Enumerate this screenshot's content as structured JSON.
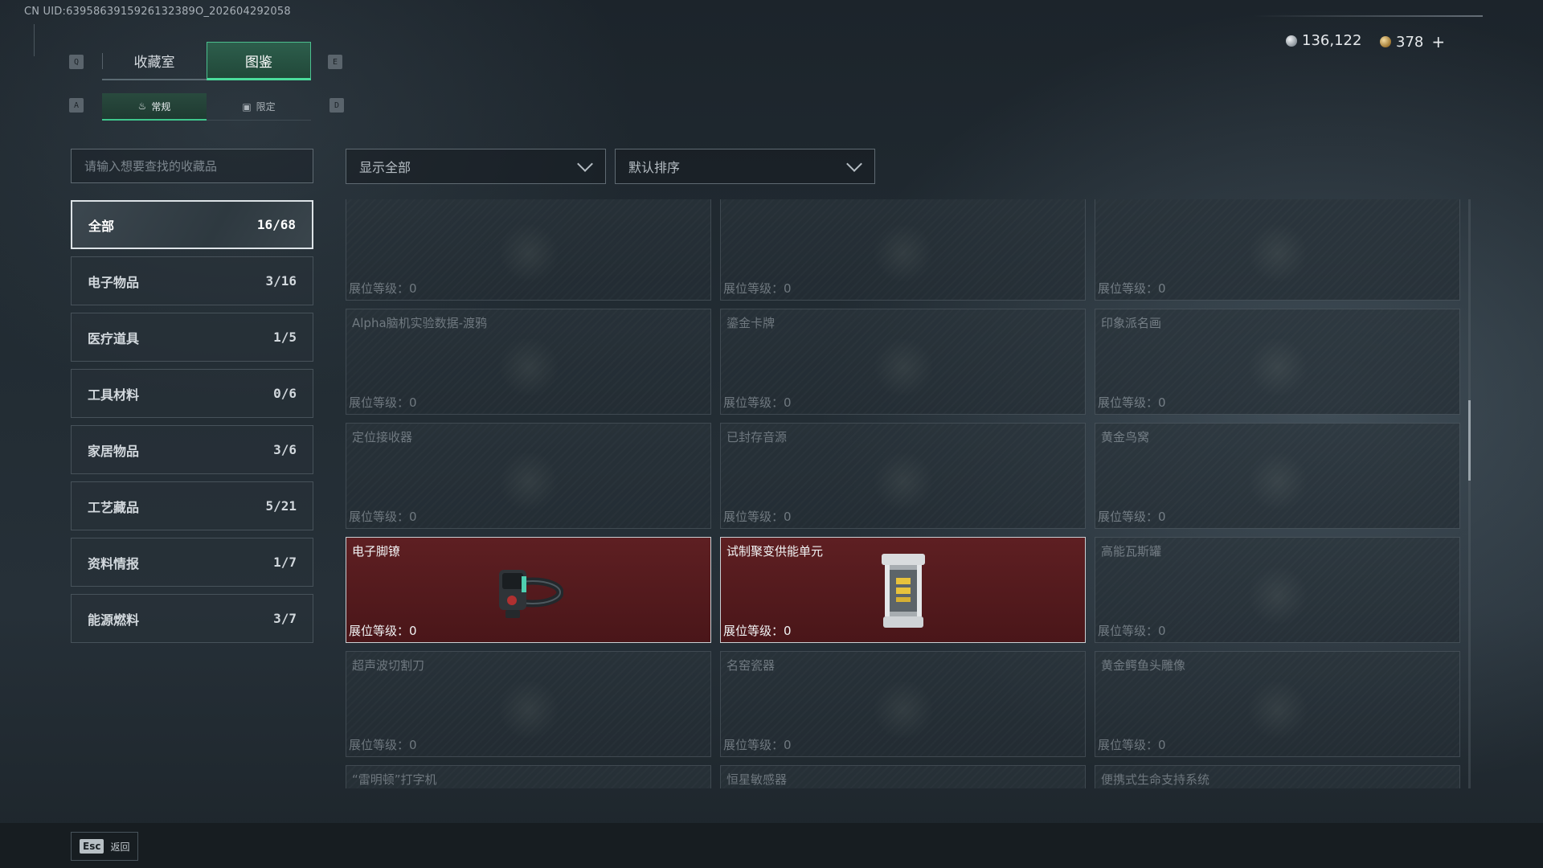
{
  "uid_text": "CN UID:6395863915926132389О_202604292058",
  "currency": {
    "silver": "136,122",
    "gold": "378",
    "plus": "+"
  },
  "keys": {
    "q": "Q",
    "e": "E",
    "a": "A",
    "d": "D"
  },
  "tabs": [
    {
      "label": "收藏室",
      "active": false
    },
    {
      "label": "图鉴",
      "active": true
    }
  ],
  "subtabs": [
    {
      "label": "常规",
      "icon": "flame-icon",
      "active": true
    },
    {
      "label": "限定",
      "icon": "box-icon",
      "active": false
    }
  ],
  "search": {
    "placeholder": "请输入想要查找的收藏品"
  },
  "categories": [
    {
      "label": "全部",
      "count": "16/68",
      "active": true
    },
    {
      "label": "电子物品",
      "count": "3/16"
    },
    {
      "label": "医疗道具",
      "count": "1/5"
    },
    {
      "label": "工具材料",
      "count": "0/6"
    },
    {
      "label": "家居物品",
      "count": "3/6"
    },
    {
      "label": "工艺藏品",
      "count": "5/21"
    },
    {
      "label": "资料情报",
      "count": "1/7"
    },
    {
      "label": "能源燃料",
      "count": "3/7"
    }
  ],
  "filters": {
    "show": "显示全部",
    "sort": "默认排序"
  },
  "level_label": "展位等级：",
  "items": [
    {
      "name": "",
      "level": "0",
      "owned": false
    },
    {
      "name": "",
      "level": "0",
      "owned": false
    },
    {
      "name": "",
      "level": "0",
      "owned": false
    },
    {
      "name": "Alpha脑机实验数据-渡鸦",
      "level": "0",
      "owned": false
    },
    {
      "name": "鎏金卡牌",
      "level": "0",
      "owned": false
    },
    {
      "name": "印象派名画",
      "level": "0",
      "owned": false
    },
    {
      "name": "定位接收器",
      "level": "0",
      "owned": false
    },
    {
      "name": "已封存音源",
      "level": "0",
      "owned": false
    },
    {
      "name": "黄金鸟窝",
      "level": "0",
      "owned": false
    },
    {
      "name": "电子脚镣",
      "level": "0",
      "owned": true,
      "icon": "ankle-monitor-icon"
    },
    {
      "name": "试制聚变供能单元",
      "level": "0",
      "owned": true,
      "icon": "fusion-cell-icon"
    },
    {
      "name": "高能瓦斯罐",
      "level": "0",
      "owned": false
    },
    {
      "name": "超声波切割刀",
      "level": "0",
      "owned": false
    },
    {
      "name": "名窑瓷器",
      "level": "0",
      "owned": false
    },
    {
      "name": "黄金鳄鱼头雕像",
      "level": "0",
      "owned": false
    },
    {
      "name": "“雷明顿”打字机",
      "level": "",
      "owned": false
    },
    {
      "name": "恒星敏感器",
      "level": "",
      "owned": false
    },
    {
      "name": "便携式生命支持系统",
      "level": "",
      "owned": false
    }
  ],
  "footer": {
    "esc_key": "Esc",
    "back": "返回"
  }
}
